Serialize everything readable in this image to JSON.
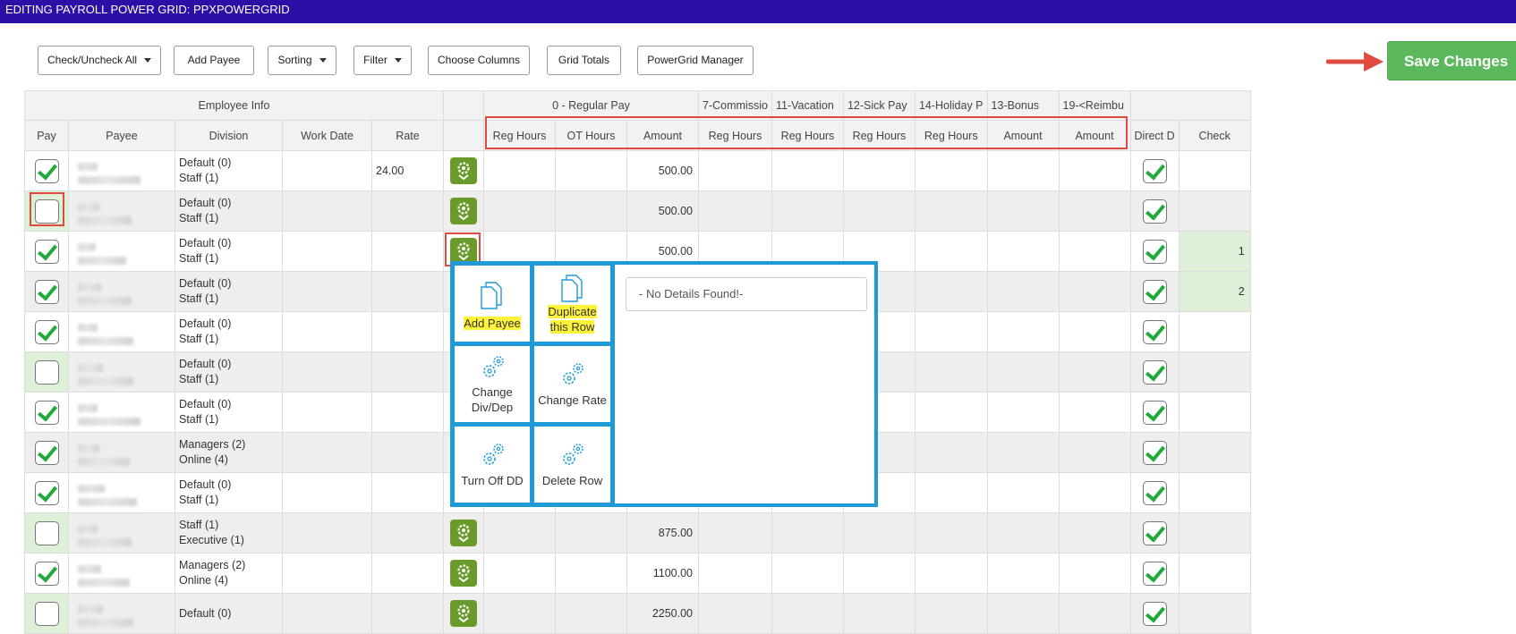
{
  "title": "EDITING PAYROLL POWER GRID: PPXPOWERGRID",
  "toolbar": {
    "check_all": "Check/Uncheck All",
    "add_payee": "Add Payee",
    "sorting": "Sorting",
    "filter": "Filter",
    "choose_columns": "Choose Columns",
    "grid_totals": "Grid Totals",
    "powergrid_manager": "PowerGrid Manager",
    "save_changes": "Save Changes"
  },
  "groups": {
    "employee_info": "Employee Info",
    "regular_pay": "0 - Regular Pay",
    "commission": "7-Commissio",
    "vacation": "11-Vacation",
    "sick_pay": "12-Sick Pay",
    "holiday": "14-Holiday P",
    "bonus": "13-Bonus",
    "reimbursement": "19-<Reimbu"
  },
  "columns": {
    "pay": "Pay",
    "payee": "Payee",
    "division": "Division",
    "work_date": "Work Date",
    "rate": "Rate",
    "reg_hours": "Reg Hours",
    "ot_hours": "OT Hours",
    "amount": "Amount",
    "direct_deposit": "Direct D",
    "check": "Check"
  },
  "rows": [
    {
      "pay": true,
      "div1": "Default (0)",
      "div2": "Staff (1)",
      "rate": "24.00",
      "amount": "500.00",
      "check": ""
    },
    {
      "pay": false,
      "div1": "Default (0)",
      "div2": "Staff (1)",
      "rate": "",
      "amount": "500.00",
      "check": ""
    },
    {
      "pay": true,
      "div1": "Default (0)",
      "div2": "Staff (1)",
      "rate": "",
      "amount": "500.00",
      "check": "1"
    },
    {
      "pay": true,
      "div1": "Default (0)",
      "div2": "Staff (1)",
      "rate": "",
      "amount": "",
      "check": "2"
    },
    {
      "pay": true,
      "div1": "Default (0)",
      "div2": "Staff (1)",
      "rate": "",
      "amount": "",
      "check": ""
    },
    {
      "pay": false,
      "div1": "Default (0)",
      "div2": "Staff (1)",
      "rate": "",
      "amount": "",
      "check": ""
    },
    {
      "pay": true,
      "div1": "Default (0)",
      "div2": "Staff (1)",
      "rate": "",
      "amount": "",
      "check": ""
    },
    {
      "pay": true,
      "div1": "Managers (2)",
      "div2": "Online (4)",
      "rate": "",
      "amount": "",
      "check": ""
    },
    {
      "pay": true,
      "div1": "Default (0)",
      "div2": "Staff (1)",
      "rate": "",
      "amount": "",
      "check": ""
    },
    {
      "pay": false,
      "div1": "Staff (1)",
      "div2": "Executive (1)",
      "rate": "",
      "amount": "875.00",
      "check": ""
    },
    {
      "pay": true,
      "div1": "Managers (2)",
      "div2": "Online (4)",
      "rate": "",
      "amount": "1100.00",
      "check": ""
    },
    {
      "pay": false,
      "div1": "Default (0)",
      "div2": "",
      "rate": "",
      "amount": "2250.00",
      "check": ""
    }
  ],
  "popup": {
    "add_payee": "Add Payee",
    "duplicate_1": "Duplicate",
    "duplicate_2": "this Row",
    "change_div_1": "Change",
    "change_div_2": "Div/Dep",
    "change_rate": "Change Rate",
    "turn_off_dd": "Turn Off DD",
    "delete_row": "Delete Row",
    "no_details": "- No Details Found!-"
  }
}
